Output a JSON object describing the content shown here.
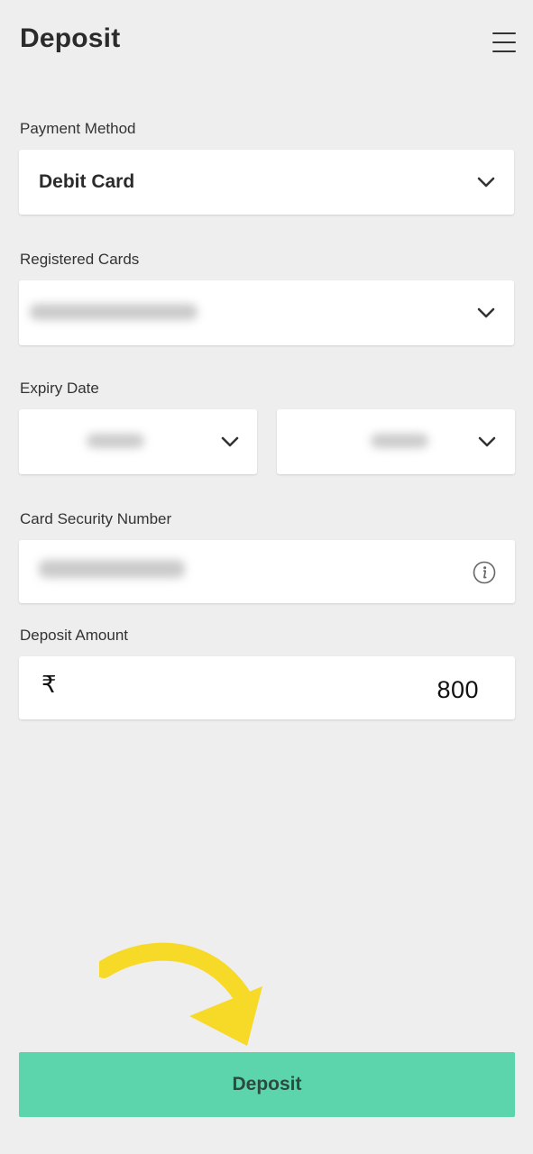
{
  "header": {
    "title": "Deposit",
    "menu_icon": "hamburger-menu-icon"
  },
  "form": {
    "payment_method": {
      "label": "Payment Method",
      "value": "Debit Card"
    },
    "registered_cards": {
      "label": "Registered Cards"
    },
    "expiry_date": {
      "label": "Expiry Date"
    },
    "card_security_number": {
      "label": "Card Security Number",
      "icon": "info-icon"
    },
    "deposit_amount": {
      "label": "Deposit Amount",
      "currency_symbol": "₹",
      "value": "800"
    }
  },
  "footer": {
    "deposit_button_label": "Deposit"
  },
  "colors": {
    "background": "#eeeeee",
    "button": "#5cd5ac",
    "arrow_annotation": "#f7d928"
  }
}
